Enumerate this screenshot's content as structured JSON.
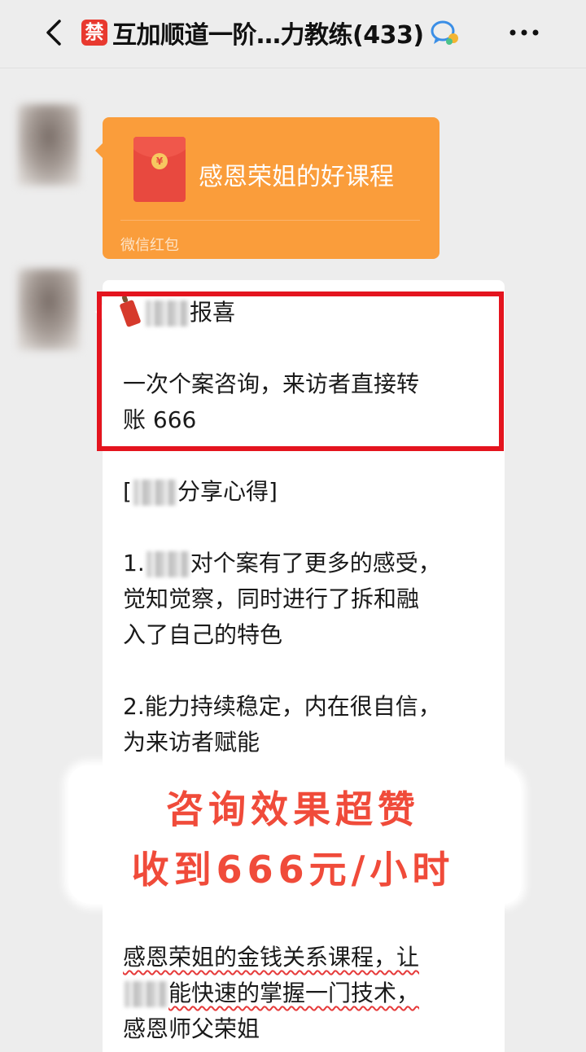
{
  "header": {
    "badge": "禁",
    "title": "互加顺道一阶…力教练(433)",
    "icons": {
      "back": "chevron-left-icon",
      "group": "group-chat-icon",
      "more": "more-dots-icon"
    }
  },
  "red_packet": {
    "title": "感恩荣姐的好课程",
    "label": "微信红包",
    "coin_symbol": "¥",
    "color": "#fa9d3b"
  },
  "message": {
    "headline_suffix": "报喜",
    "summary_line1": "一次个案咨询，来访者直接转",
    "summary_line2": "账 666",
    "share_open": "[",
    "share_suffix": "分享心得]",
    "point1_prefix": "1.",
    "point1_line1": "对个案有了更多的感受，",
    "point1_line2": "觉知觉察，同时进行了拆和融",
    "point1_line3": "入了自己的特色",
    "point2_line1": "2.能力持续稳定，内在很自信，",
    "point2_line2": "为来访者赋能",
    "closing_line1": "感恩荣姐的金钱关系课程，让",
    "closing_line2": "能快速的掌握一门技术，",
    "closing_line3": "感恩师父荣姐"
  },
  "promo": {
    "line1": "咨询效果超赞",
    "line2": "收到666元/小时",
    "color": "#f04b3a"
  },
  "highlight_color": "#e4141e"
}
